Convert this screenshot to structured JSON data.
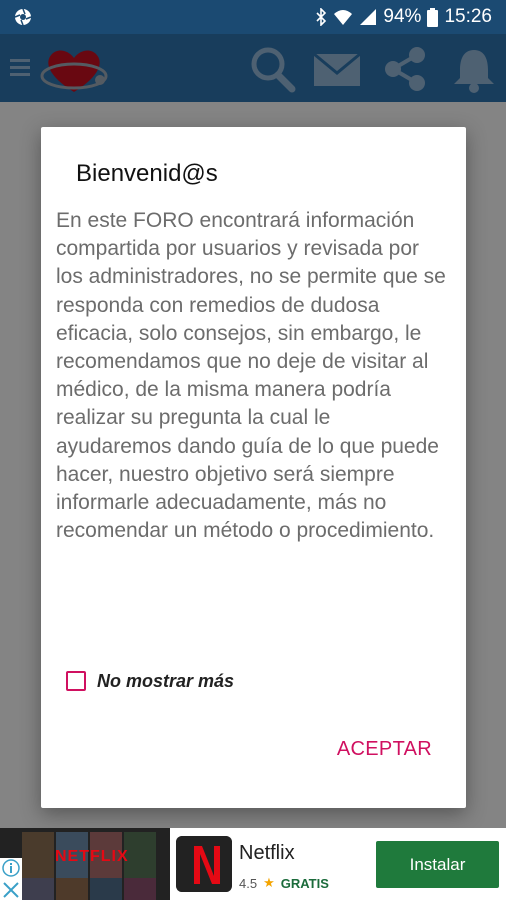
{
  "status_bar": {
    "battery": "94%",
    "time": "15:26",
    "icons": [
      "camera-aperture-icon",
      "bluetooth-icon",
      "wifi-icon",
      "signal-icon",
      "battery-icon"
    ]
  },
  "toolbar": {
    "icons": [
      "menu-icon",
      "logo-heart-stethoscope",
      "search-icon",
      "mail-icon",
      "share-icon",
      "bell-icon"
    ]
  },
  "dialog": {
    "title": "Bienvenid@s",
    "message": "En este FORO encontrará información compartida por usuarios y revisada por los administradores, no se permite que se responda con remedios de dudosa eficacia, solo consejos, sin embargo, le recomendamos que no deje de visitar al médico, de la misma manera podría realizar su pregunta la cual le ayudaremos dando guía de lo que puede hacer, nuestro objetivo será siempre informarle adecuadamente, más no recomendar un método o procedimiento.",
    "checkbox_label": "No mostrar más",
    "checkbox_checked": false,
    "accept_label": "ACEPTAR"
  },
  "ad": {
    "brand_text": "NETFLIX",
    "app_name": "Netflix",
    "rating": "4.5",
    "price_label": "GRATIS",
    "install_label": "Instalar"
  },
  "colors": {
    "status_bar": "#1b4a72",
    "toolbar": "#2c6fa8",
    "accent": "#d01060",
    "install_button": "#1f7a3c"
  }
}
